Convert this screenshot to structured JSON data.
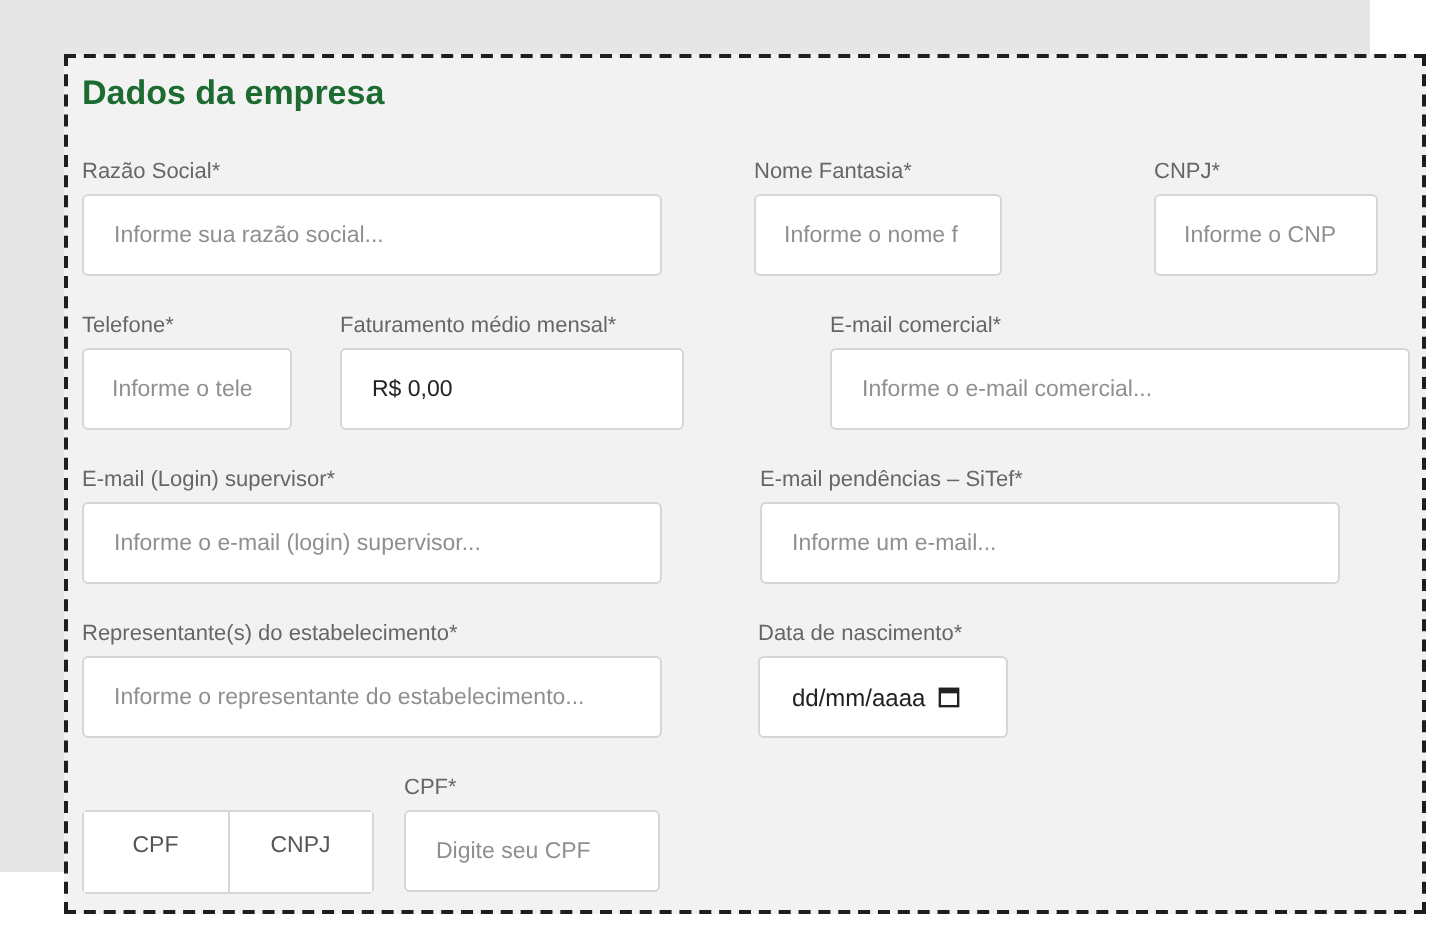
{
  "section": {
    "title": "Dados da empresa"
  },
  "rows": [
    {
      "fields": [
        {
          "kind": "text",
          "label": "Razão Social*",
          "placeholder": "Informe sua razão social..."
        },
        {
          "kind": "text",
          "label": "Nome Fantasia*",
          "placeholder": "Informe o nome f"
        },
        {
          "kind": "text",
          "label": "CNPJ*",
          "placeholder": "Informe o CNP"
        }
      ]
    },
    {
      "fields": [
        {
          "kind": "text",
          "label": "Telefone*",
          "placeholder": "Informe o tele"
        },
        {
          "kind": "text",
          "label": "Faturamento médio mensal*",
          "value": "R$ 0,00"
        },
        {
          "kind": "text",
          "label": "E-mail comercial*",
          "placeholder": "Informe o e-mail comercial..."
        }
      ]
    },
    {
      "fields": [
        {
          "kind": "text",
          "label": "E-mail (Login) supervisor*",
          "placeholder": "Informe o e-mail (login) supervisor..."
        },
        {
          "kind": "text",
          "label": "E-mail pendências – SiTef*",
          "placeholder": "Informe um e-mail..."
        }
      ]
    },
    {
      "fields": [
        {
          "kind": "text",
          "label": "Representante(s) do estabelecimento*",
          "placeholder": "Informe o representante do estabelecimento..."
        },
        {
          "kind": "date",
          "label": "Data de nascimento*",
          "value": "dd/mm/aaaa"
        }
      ]
    },
    {
      "fields": [
        {
          "kind": "toggle",
          "options": [
            {
              "label": "CPF",
              "selected": false
            },
            {
              "label": "CNPJ",
              "selected": false
            }
          ]
        },
        {
          "kind": "text",
          "label": "CPF*",
          "placeholder": "Digite seu CPF"
        }
      ]
    }
  ]
}
